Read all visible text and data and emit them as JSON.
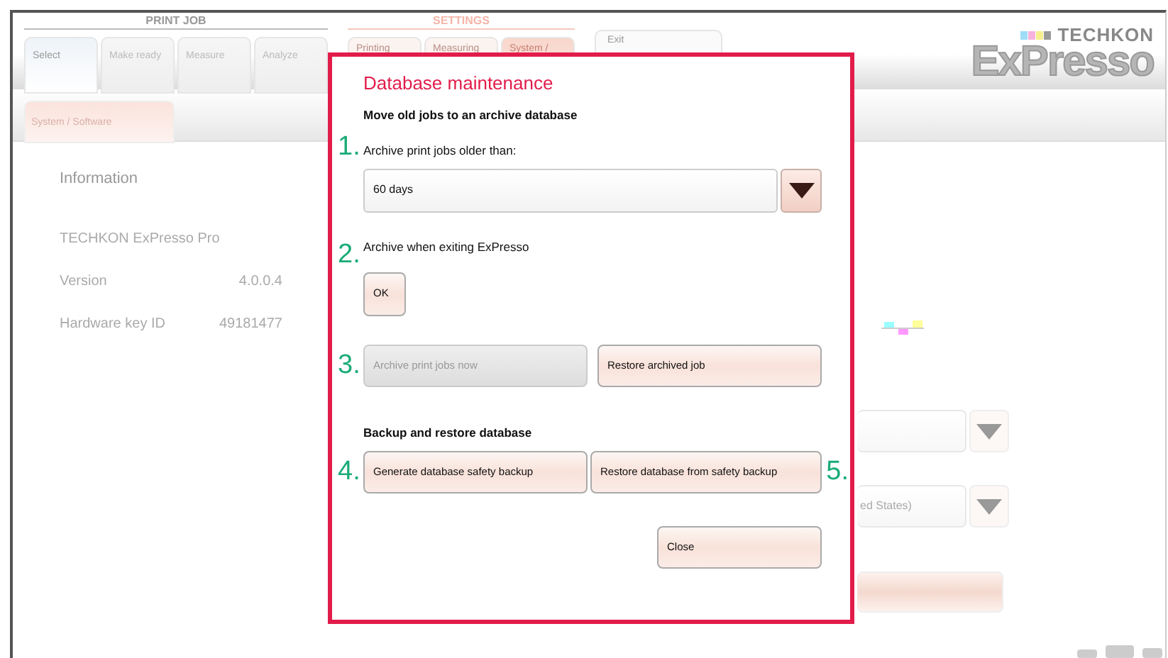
{
  "header": {
    "groups": [
      {
        "title": "PRINT JOB",
        "kind": "print",
        "tabs": [
          {
            "label": "Select",
            "selected": true
          },
          {
            "label": "Make ready",
            "selected": false
          },
          {
            "label": "Measure",
            "selected": false
          },
          {
            "label": "Analyze",
            "selected": false
          }
        ]
      },
      {
        "title": "SETTINGS",
        "kind": "settings",
        "tabs": [
          {
            "label": "Printing",
            "selected": false
          },
          {
            "label": "Measuring",
            "selected": false
          },
          {
            "label": "System /",
            "selected": true
          }
        ]
      }
    ],
    "exit_tab": {
      "label": "Exit"
    },
    "logo": {
      "brand": "TECHKON",
      "product": "ExPresso"
    }
  },
  "subtabs": [
    {
      "label": "System / Software",
      "selected": true
    }
  ],
  "information": {
    "title": "Information",
    "product": "TECHKON ExPresso Pro",
    "rows": [
      {
        "label": "Version",
        "value": "4.0.0.4"
      },
      {
        "label": "Hardware key ID",
        "value": "49181477"
      }
    ]
  },
  "background_panel": {
    "region_value": "ed States)"
  },
  "dialog": {
    "title": "Database maintenance",
    "items": [
      {
        "kind": "heading",
        "text": "Move old jobs to an archive database"
      },
      {
        "kind": "label",
        "marker": "1.",
        "text": "Archive print jobs older than:"
      },
      {
        "kind": "dropdown",
        "value": "60 days"
      },
      {
        "kind": "label",
        "marker": "2.",
        "text": "Archive when exiting ExPresso"
      },
      {
        "kind": "toggle",
        "label": "OK"
      },
      {
        "kind": "buttons",
        "marker": "3.",
        "buttons": [
          {
            "label": "Archive print jobs now",
            "disabled": true
          },
          {
            "label": "Restore archived job",
            "disabled": false
          }
        ]
      },
      {
        "kind": "heading",
        "text": "Backup and restore database"
      },
      {
        "kind": "buttons",
        "marker": "4.",
        "marker_after": "5.",
        "buttons": [
          {
            "label": "Generate database safety backup",
            "disabled": false
          },
          {
            "label": "Restore database from safety backup",
            "disabled": false
          }
        ]
      },
      {
        "kind": "close",
        "label": "Close"
      }
    ]
  }
}
